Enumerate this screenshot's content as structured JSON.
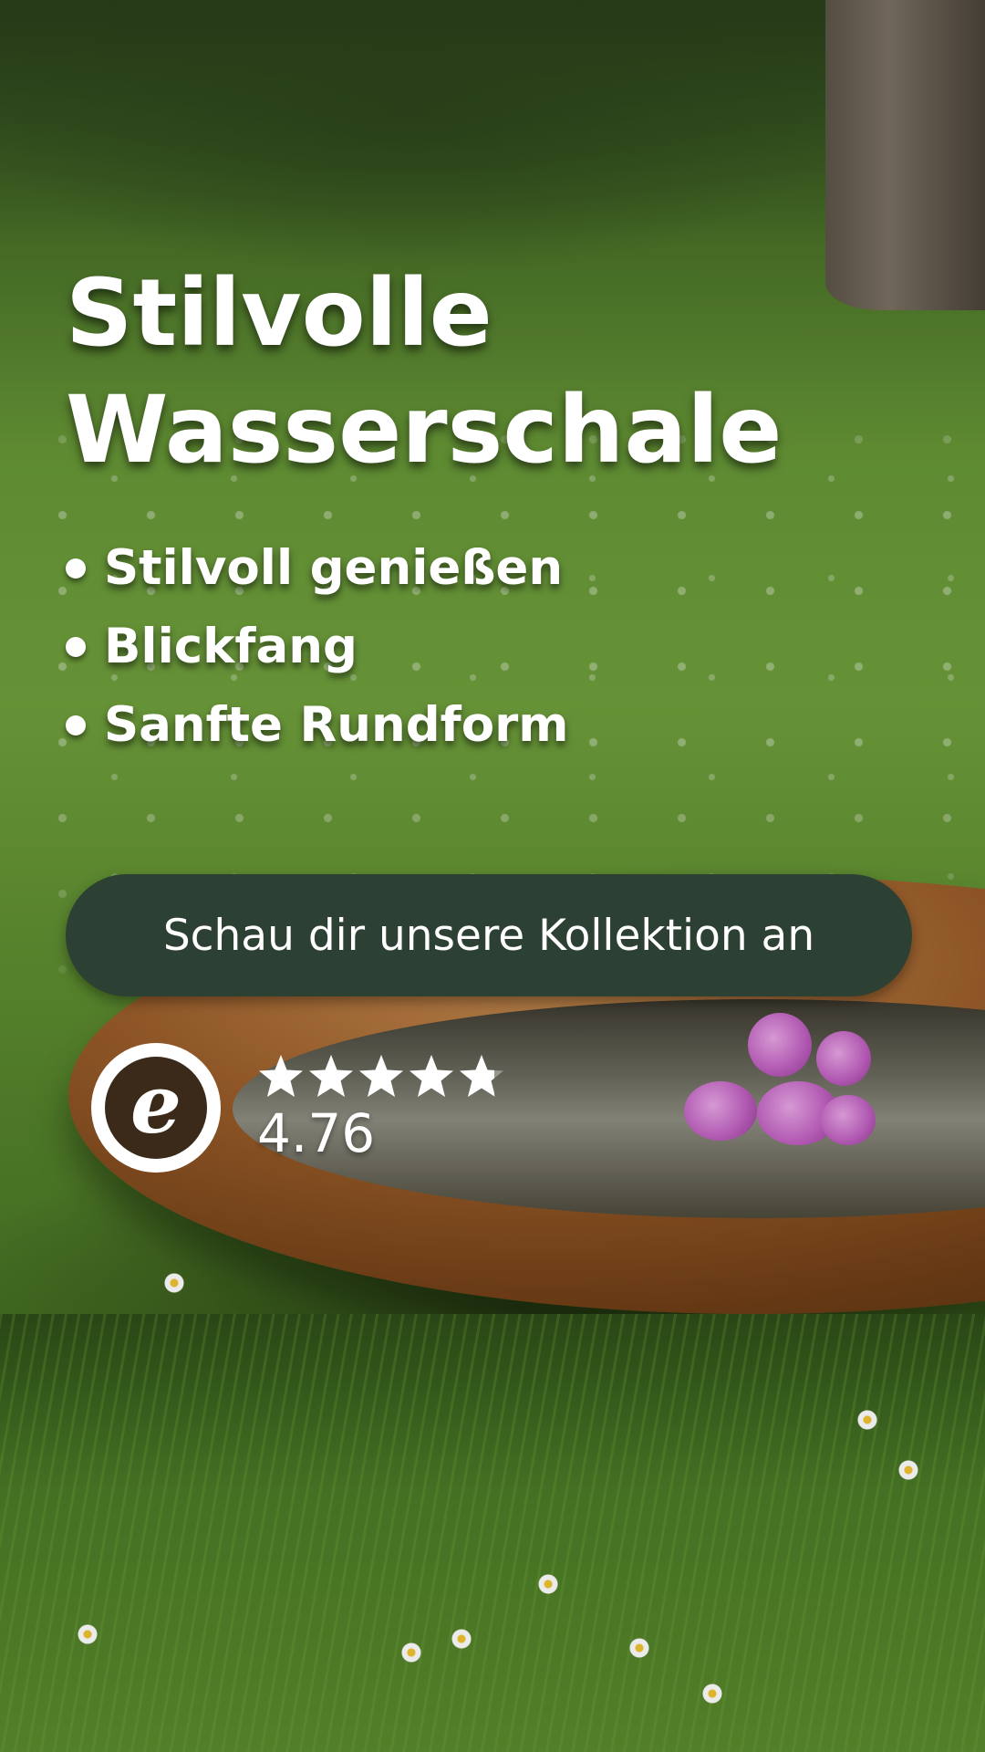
{
  "ad": {
    "headline_line1": "Stilvolle",
    "headline_line2": "Wasserschale",
    "bullets": [
      "Stilvoll genießen",
      "Blickfang",
      "Sanfte Rundform"
    ],
    "cta_label": "Schau dir unsere Kollektion an"
  },
  "rating": {
    "logo_letter": "e",
    "score_text": "4.76",
    "score": 4.76,
    "max_stars": 5,
    "star_color": "#ffffff"
  },
  "colors": {
    "button_bg": "#2c4033",
    "text": "#ffffff"
  },
  "icons": {
    "logo": "trusted-shops-e-icon",
    "star": "star-icon"
  }
}
